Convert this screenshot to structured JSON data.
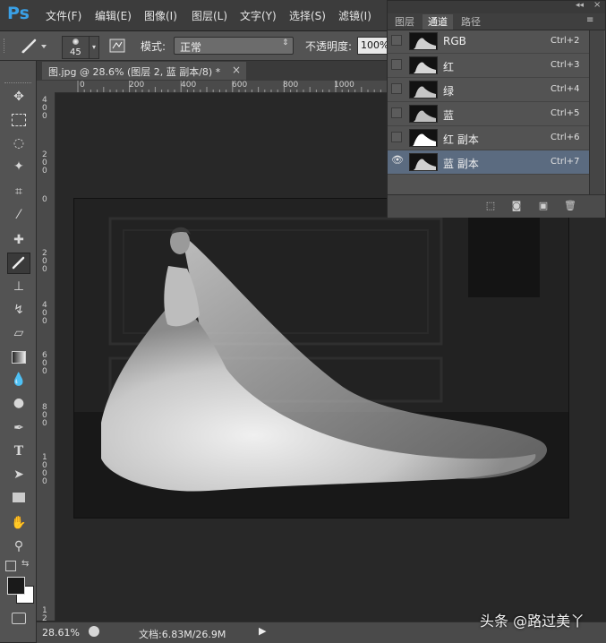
{
  "app": {
    "logo_text": "Ps"
  },
  "menu": [
    "文件(F)",
    "编辑(E)",
    "图像(I)",
    "图层(L)",
    "文字(Y)",
    "选择(S)",
    "滤镜(I)"
  ],
  "options": {
    "brush_size": "45",
    "mode_label": "模式:",
    "mode_value": "正常",
    "opacity_label": "不透明度:",
    "opacity_value": "100%"
  },
  "document": {
    "tab_title": "图.jpg @ 28.6% (图层 2, 蓝 副本/8) *",
    "close_glyph": "×"
  },
  "rulers": {
    "top": [
      "0",
      "200",
      "400",
      "600",
      "800",
      "1000"
    ],
    "left": [
      "4 0 0",
      "2 0 0",
      "0",
      "2 0 0",
      "4 0 0",
      "6 0 0",
      "8 0 0",
      "1 0 0 0",
      "1 2"
    ]
  },
  "panel": {
    "tabs": [
      "图层",
      "通道",
      "路径"
    ],
    "active_tab": "通道",
    "channels": [
      {
        "name": "RGB",
        "shortcut": "Ctrl+2",
        "visible": false,
        "selected": false
      },
      {
        "name": "红",
        "shortcut": "Ctrl+3",
        "visible": false,
        "selected": false
      },
      {
        "name": "绿",
        "shortcut": "Ctrl+4",
        "visible": false,
        "selected": false
      },
      {
        "name": "蓝",
        "shortcut": "Ctrl+5",
        "visible": false,
        "selected": false
      },
      {
        "name": "红 副本",
        "shortcut": "Ctrl+6",
        "visible": false,
        "selected": false
      },
      {
        "name": "蓝 副本",
        "shortcut": "Ctrl+7",
        "visible": true,
        "selected": true
      }
    ]
  },
  "status": {
    "zoom": "28.61%",
    "doc_info": "文档:6.83M/26.9M"
  },
  "watermark": "头条 @路过美丫",
  "colors": {
    "accent": "#3aa0e6",
    "selected_row": "#5b6b80",
    "foreground": "#1a1a1a",
    "background": "#ffffff"
  }
}
